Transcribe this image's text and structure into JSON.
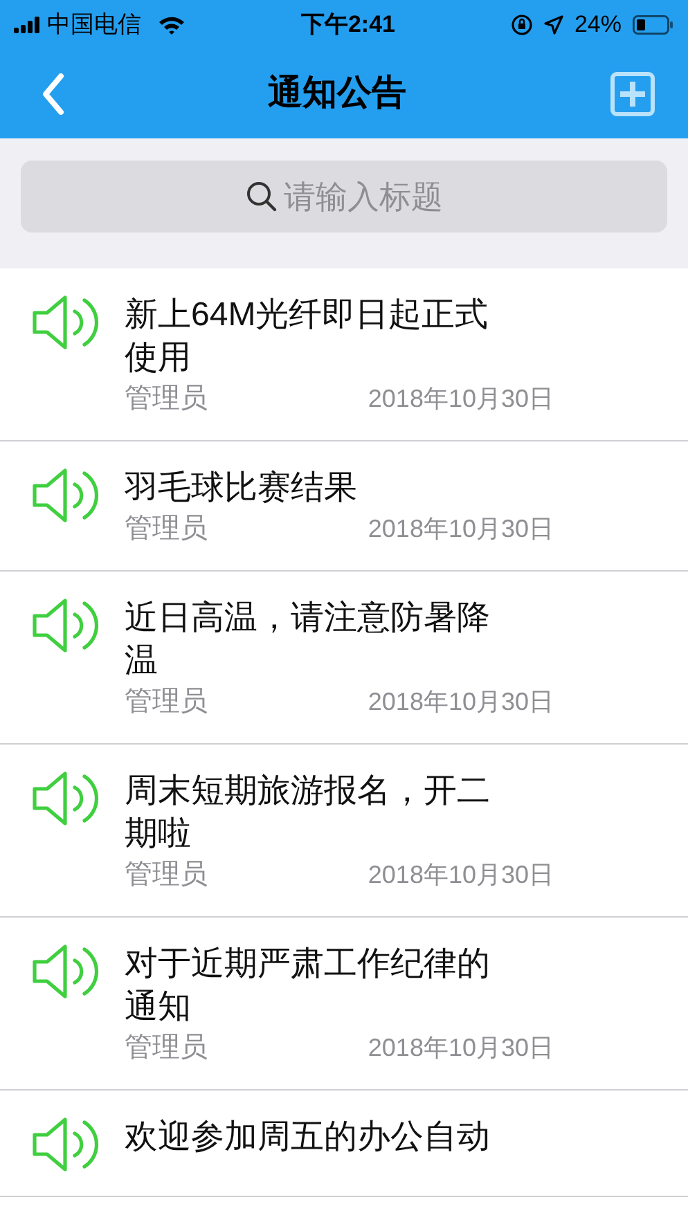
{
  "status_bar": {
    "carrier": "中国电信",
    "time": "下午2:41",
    "battery": "24%"
  },
  "nav_bar": {
    "title": "通知公告"
  },
  "search": {
    "placeholder": "请输入标题"
  },
  "notices": [
    {
      "title": "新上64M光纤即日起正式使用",
      "date": "2018年10月30日",
      "author": "管理员"
    },
    {
      "title": "羽毛球比赛结果",
      "date": "2018年10月30日",
      "author": "管理员"
    },
    {
      "title": "近日高温，请注意防暑降温",
      "date": "2018年10月30日",
      "author": "管理员"
    },
    {
      "title": "周末短期旅游报名，开二期啦",
      "date": "2018年10月30日",
      "author": "管理员"
    },
    {
      "title": "对于近期严肃工作纪律的通知",
      "date": "2018年10月30日",
      "author": "管理员"
    },
    {
      "title": "欢迎参加周五的办公自动"
    }
  ]
}
